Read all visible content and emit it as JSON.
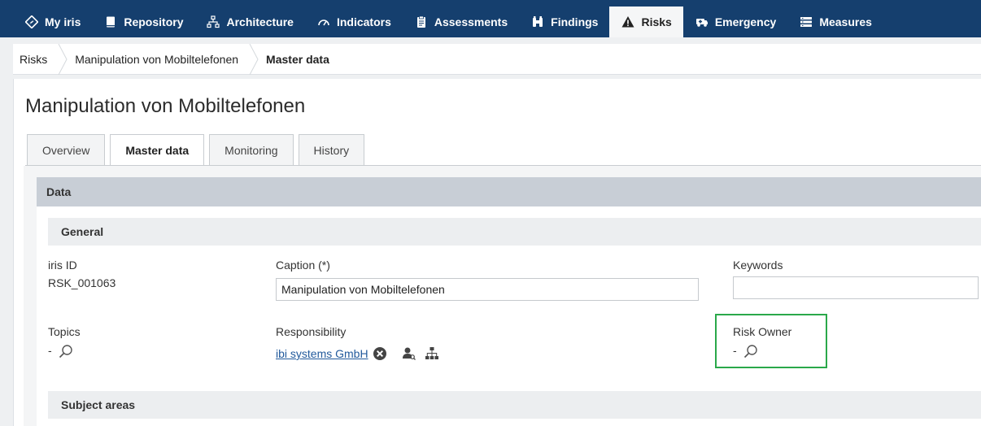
{
  "nav": {
    "items": [
      {
        "label": "My iris",
        "icon": "diamond-compass-icon",
        "active": false
      },
      {
        "label": "Repository",
        "icon": "book-icon",
        "active": false
      },
      {
        "label": "Architecture",
        "icon": "org-chart-icon",
        "active": false
      },
      {
        "label": "Indicators",
        "icon": "gauge-icon",
        "active": false
      },
      {
        "label": "Assessments",
        "icon": "clipboard-icon",
        "active": false
      },
      {
        "label": "Findings",
        "icon": "binoculars-icon",
        "active": false
      },
      {
        "label": "Risks",
        "icon": "warning-icon",
        "active": true
      },
      {
        "label": "Emergency",
        "icon": "ambulance-icon",
        "active": false
      },
      {
        "label": "Measures",
        "icon": "list-icon",
        "active": false
      }
    ]
  },
  "breadcrumb": {
    "items": [
      "Risks",
      "Manipulation von Mobiltelefonen",
      "Master data"
    ]
  },
  "page": {
    "title": "Manipulation von Mobiltelefonen"
  },
  "tabs": [
    "Overview",
    "Master data",
    "Monitoring",
    "History"
  ],
  "data_section": {
    "label": "Data",
    "general_label": "General",
    "subject_areas_label": "Subject areas"
  },
  "fields": {
    "iris_id_label": "iris ID",
    "iris_id_value": "RSK_001063",
    "caption_label": "Caption (*)",
    "caption_value": "Manipulation von Mobiltelefonen",
    "keywords_label": "Keywords",
    "keywords_value": "",
    "topics_label": "Topics",
    "topics_value": "-",
    "responsibility_label": "Responsibility",
    "responsibility_value": "ibi systems GmbH",
    "risk_owner_label": "Risk Owner",
    "risk_owner_value": "-"
  },
  "colors": {
    "nav_bg": "#153f6e",
    "highlight": "#2aa84a",
    "link": "#225a9c"
  }
}
